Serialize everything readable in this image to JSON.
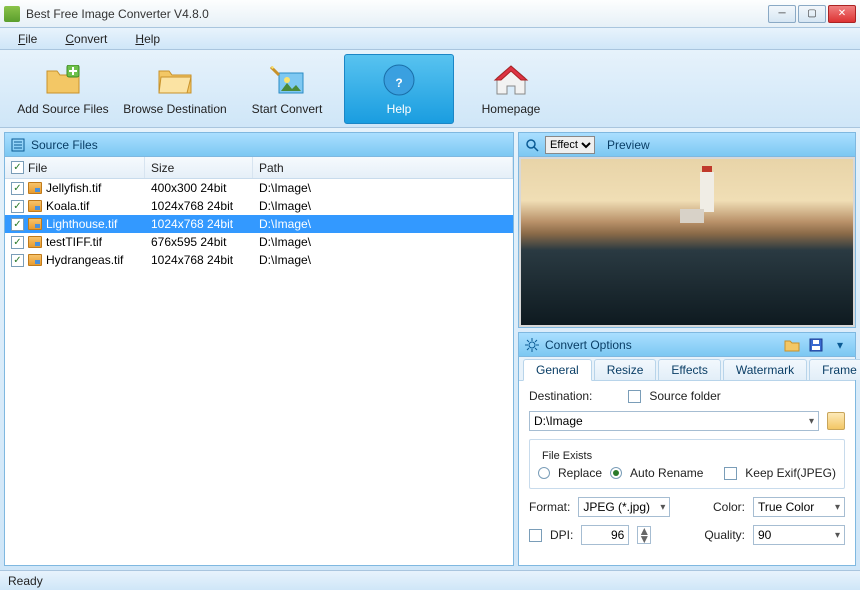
{
  "window": {
    "title": "Best Free Image Converter V4.8.0"
  },
  "menu": {
    "file": "File",
    "convert": "Convert",
    "help": "Help"
  },
  "toolbar": {
    "add": "Add Source Files",
    "browse": "Browse Destination",
    "start": "Start Convert",
    "help": "Help",
    "home": "Homepage"
  },
  "panels": {
    "source": "Source Files",
    "preview": "Preview",
    "effect": "Effect",
    "options": "Convert Options"
  },
  "columns": {
    "file": "File",
    "size": "Size",
    "path": "Path"
  },
  "files": [
    {
      "name": "Jellyfish.tif",
      "size": "400x300  24bit",
      "path": "D:\\Image\\",
      "selected": false
    },
    {
      "name": "Koala.tif",
      "size": "1024x768  24bit",
      "path": "D:\\Image\\",
      "selected": false
    },
    {
      "name": "Lighthouse.tif",
      "size": "1024x768  24bit",
      "path": "D:\\Image\\",
      "selected": true
    },
    {
      "name": "testTIFF.tif",
      "size": "676x595  24bit",
      "path": "D:\\Image\\",
      "selected": false
    },
    {
      "name": "Hydrangeas.tif",
      "size": "1024x768  24bit",
      "path": "D:\\Image\\",
      "selected": false
    }
  ],
  "tabs": {
    "general": "General",
    "resize": "Resize",
    "effects": "Effects",
    "watermark": "Watermark",
    "frame": "Frame"
  },
  "general": {
    "destination_label": "Destination:",
    "source_folder": "Source folder",
    "destination_value": "D:\\Image",
    "file_exists_label": "File Exists",
    "replace": "Replace",
    "auto_rename": "Auto Rename",
    "keep_exif": "Keep Exif(JPEG)",
    "format_label": "Format:",
    "format_value": "JPEG (*.jpg)",
    "color_label": "Color:",
    "color_value": "True Color",
    "dpi_label": "DPI:",
    "dpi_value": "96",
    "quality_label": "Quality:",
    "quality_value": "90"
  },
  "status": "Ready"
}
